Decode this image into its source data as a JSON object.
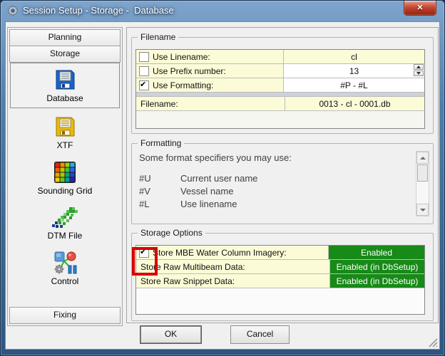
{
  "titlebar": {
    "title": "Session Setup - Storage -  Database",
    "close_glyph": "✕"
  },
  "sidebar": {
    "planning": "Planning",
    "storage": "Storage",
    "items": [
      {
        "label": "Database",
        "icon": "floppy-blue-icon",
        "selected": true
      },
      {
        "label": "XTF",
        "icon": "floppy-yellow-icon",
        "selected": false
      },
      {
        "label": "Sounding Grid",
        "icon": "rainbow-grid-icon",
        "selected": false
      },
      {
        "label": "DTM File",
        "icon": "dtm-scatter-icon",
        "selected": false
      },
      {
        "label": "Control",
        "icon": "control-nodes-icon",
        "selected": false
      }
    ],
    "fixing": "Fixing"
  },
  "filename_group": {
    "title": "Filename",
    "rows": [
      {
        "label": "Use Linename:",
        "checked": false,
        "value": "cl"
      },
      {
        "label": "Use Prefix number:",
        "checked": false,
        "value": "13"
      },
      {
        "label": "Use Formatting:",
        "checked": true,
        "value": "#P - #L"
      }
    ],
    "result": {
      "label": "Filename:",
      "value": "0013 - cl - 0001.db"
    }
  },
  "formatting_group": {
    "title": "Formatting",
    "intro": "Some format specifiers you may use:",
    "specifiers": [
      {
        "code": "#U",
        "desc": "Current user name"
      },
      {
        "code": "#V",
        "desc": "Vessel name"
      },
      {
        "code": "#L",
        "desc": "Use linename"
      }
    ]
  },
  "storage_group": {
    "title": "Storage Options",
    "rows": [
      {
        "label": "Store MBE Water Column Imagery:",
        "checked": true,
        "value": "Enabled",
        "annotated": true
      },
      {
        "label": "Store Raw Multibeam Data:",
        "value": "Enabled (in DbSetup)"
      },
      {
        "label": "Store Raw Snippet Data:",
        "value": "Enabled (in DbSetup)"
      }
    ]
  },
  "footer": {
    "ok": "OK",
    "cancel": "Cancel"
  },
  "colors": {
    "label_yellow": "#FBFBD7",
    "enabled_green": "#178A17",
    "annotation_red": "#D90000",
    "titlebar_blue": "#4F7DAC",
    "close_red": "#C2432C"
  },
  "icons": {
    "title": "gear-icon",
    "close": "close-icon",
    "database": "floppy-blue-icon",
    "xtf": "floppy-yellow-icon",
    "sounding_grid": "rainbow-grid-icon",
    "dtm_file": "dtm-scatter-icon",
    "control": "control-nodes-icon",
    "resize": "resize-grip-icon"
  }
}
